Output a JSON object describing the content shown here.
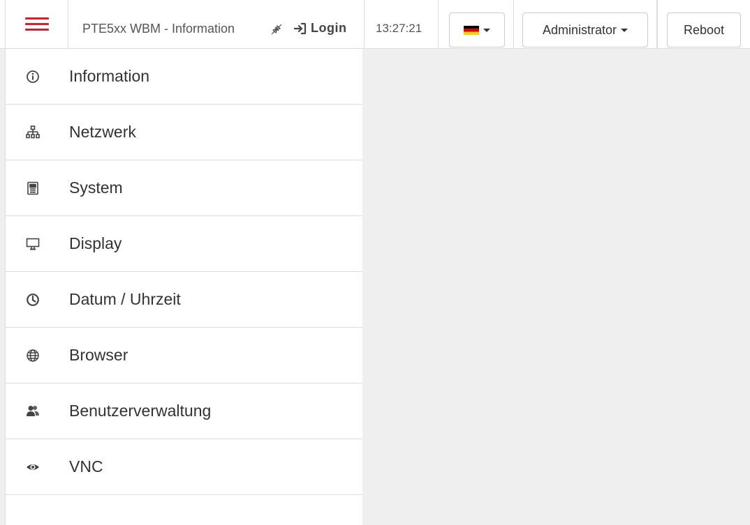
{
  "header": {
    "title": "PTE5xx WBM - Information",
    "login_label": "Login",
    "time": "13:27:21",
    "language": {
      "flag": "de",
      "flag_colors": [
        "#000000",
        "#dd0000",
        "#ffce00"
      ]
    },
    "user_label": "Administrator",
    "reboot_label": "Reboot"
  },
  "colors": {
    "accent": "#d4202a",
    "content_bg": "#efefef"
  },
  "sidebar": {
    "items": [
      {
        "label": "Information",
        "icon": "info-icon"
      },
      {
        "label": "Netzwerk",
        "icon": "network-icon"
      },
      {
        "label": "System",
        "icon": "system-icon"
      },
      {
        "label": "Display",
        "icon": "monitor-icon"
      },
      {
        "label": "Datum / Uhrzeit",
        "icon": "clock-icon"
      },
      {
        "label": "Browser",
        "icon": "globe-icon"
      },
      {
        "label": "Benutzerverwaltung",
        "icon": "users-icon"
      },
      {
        "label": "VNC",
        "icon": "eye-icon"
      }
    ]
  }
}
